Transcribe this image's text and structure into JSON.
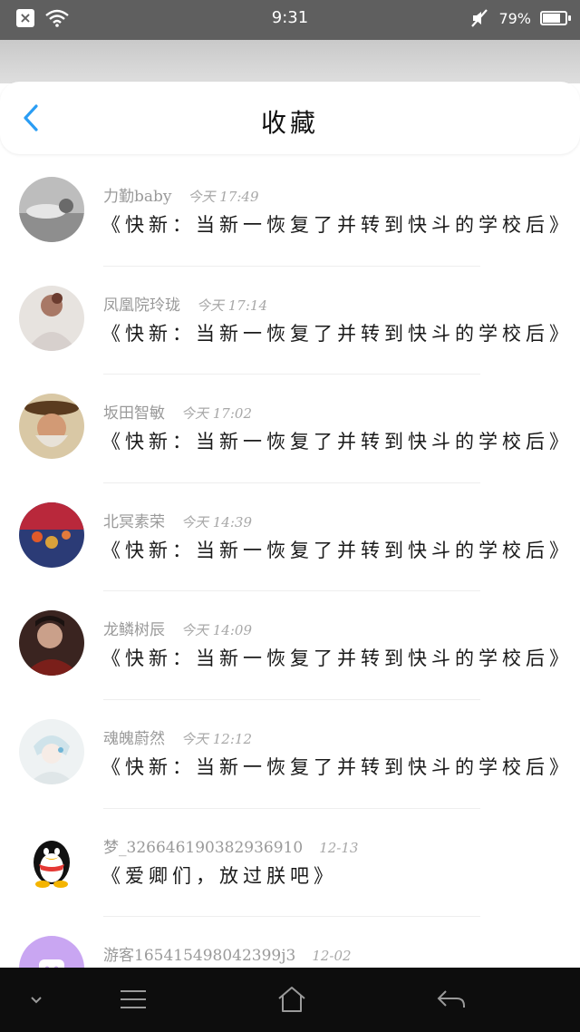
{
  "status_bar": {
    "time": "9:31",
    "battery": "79%",
    "battery_level": 0.79
  },
  "header": {
    "title": "收藏",
    "back_icon": "chevron-left-icon",
    "accent_color": "#2a9df4"
  },
  "items": [
    {
      "name": "力勤baby",
      "time": "今天 17:49",
      "title": "《快新：当新一恢复了并转到快斗的学校后》"
    },
    {
      "name": "凤凰院玲珑",
      "time": "今天 17:14",
      "title": "《快新：当新一恢复了并转到快斗的学校后》"
    },
    {
      "name": "坂田智敏",
      "time": "今天 17:02",
      "title": "《快新：当新一恢复了并转到快斗的学校后》"
    },
    {
      "name": "北冥素荣",
      "time": "今天 14:39",
      "title": "《快新：当新一恢复了并转到快斗的学校后》"
    },
    {
      "name": "龙鳞树辰",
      "time": "今天 14:09",
      "title": "《快新：当新一恢复了并转到快斗的学校后》"
    },
    {
      "name": "魂魄蔚然",
      "time": "今天 12:12",
      "title": "《快新：当新一恢复了并转到快斗的学校后》"
    },
    {
      "name": "梦_326646190382936910",
      "time": "12-13",
      "title": "《爱卿们，放过朕吧》"
    },
    {
      "name": "游客165415498042399j3",
      "time": "12-02",
      "title": ""
    }
  ],
  "nav": {
    "buttons": [
      "chevron-down-icon",
      "menu-icon",
      "home-icon",
      "back-arrow-icon"
    ]
  }
}
